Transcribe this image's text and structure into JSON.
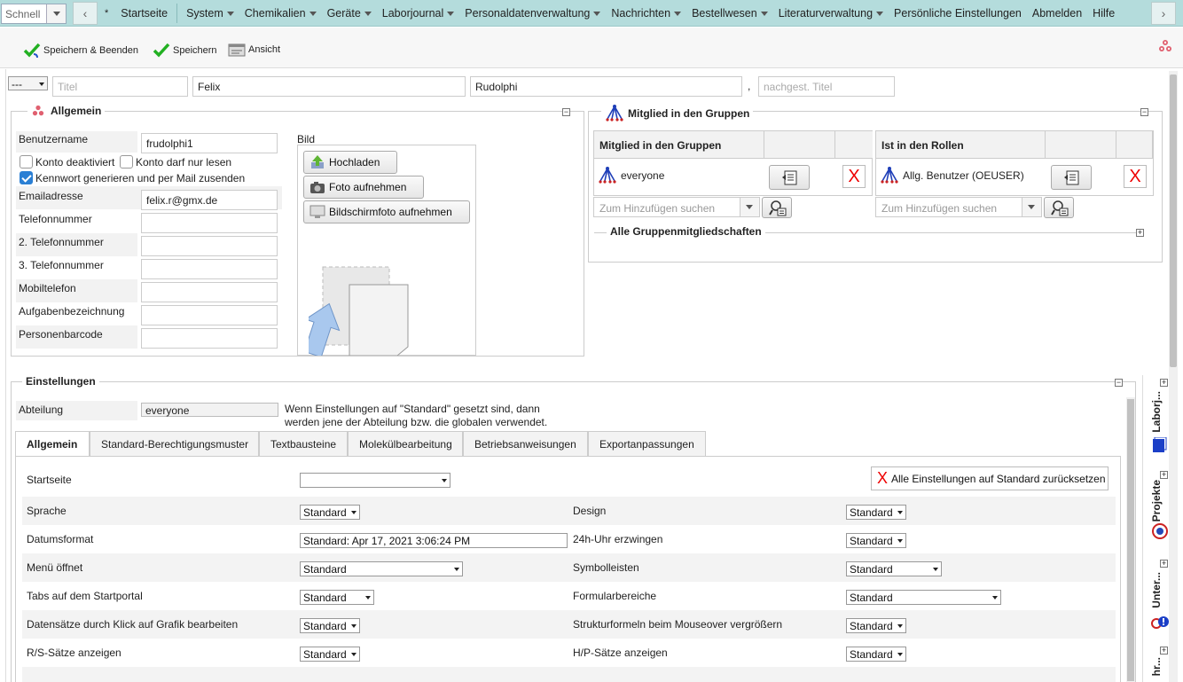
{
  "nav": {
    "quick_value": "Schnell",
    "star": "*",
    "items": [
      {
        "label": "Startseite",
        "dd": false
      },
      {
        "label": "System",
        "dd": true
      },
      {
        "label": "Chemikalien",
        "dd": true
      },
      {
        "label": "Geräte",
        "dd": true
      },
      {
        "label": "Laborjournal",
        "dd": true
      },
      {
        "label": "Personaldatenverwaltung",
        "dd": true
      },
      {
        "label": "Nachrichten",
        "dd": true
      },
      {
        "label": "Bestellwesen",
        "dd": true
      },
      {
        "label": "Literaturverwaltung",
        "dd": true
      },
      {
        "label": "Persönliche Einstellungen",
        "dd": false
      },
      {
        "label": "Abmelden",
        "dd": false
      },
      {
        "label": "Hilfe",
        "dd": false
      }
    ]
  },
  "toolbar": {
    "save_close": "Speichern & Beenden",
    "save": "Speichern",
    "view": "Ansicht"
  },
  "name_row": {
    "salutation": "---",
    "title_placeholder": "Titel",
    "first_name": "Felix",
    "last_name": "Rudolphi",
    "comma": ",",
    "post_title_placeholder": "nachgest. Titel"
  },
  "general": {
    "legend": "Allgemein",
    "username_label": "Benutzername",
    "username": "frudolphi1",
    "disabled_label": "Konto deaktiviert",
    "readonly_label": "Konto darf nur lesen",
    "pw_label": "Kennwort generieren und per Mail zusenden",
    "email_label": "Emailadresse",
    "email": "felix.r@gmx.de",
    "phone_label": "Telefonnummer",
    "phone2_label": "2. Telefonnummer",
    "phone3_label": "3. Telefonnummer",
    "mobile_label": "Mobiltelefon",
    "task_label": "Aufgabenbezeichnung",
    "barcode_label": "Personenbarcode",
    "image_label": "Bild",
    "upload": "Hochladen",
    "photo": "Foto aufnehmen",
    "screenshot": "Bildschirmfoto aufnehmen"
  },
  "groups": {
    "legend": "Mitglied in den Gruppen",
    "col_groups": "Mitglied in den Gruppen",
    "col_roles": "Ist in den Rollen",
    "group1": "everyone",
    "role1": "Allg. Benutzer (OEUSER)",
    "add_placeholder": "Zum Hinzufügen suchen",
    "remove_x": "X",
    "all_memberships": "Alle Gruppenmitgliedschaften"
  },
  "settings": {
    "legend": "Einstellungen",
    "department_label": "Abteilung",
    "department": "everyone",
    "note": "Wenn Einstellungen auf \"Standard\" gesetzt sind, dann werden jene der Abteilung bzw. die globalen verwendet.",
    "tabs": [
      "Allgemein",
      "Standard-Berechtigungsmuster",
      "Textbausteine",
      "Molekülbearbeitung",
      "Betriebsanweisungen",
      "Exportanpassungen"
    ],
    "startpage_label": "Startseite",
    "reset_x": "X",
    "reset_label": "Alle Einstellungen auf Standard zurücksetzen",
    "rows": [
      {
        "left": "Sprache",
        "lval": "Standard",
        "right": "Design",
        "rval": "Standard"
      },
      {
        "left": "Datumsformat",
        "lval": "Standard: Apr 17, 2021 3:06:24 PM",
        "right": "24h-Uhr erzwingen",
        "rval": "Standard"
      },
      {
        "left": "Menü öffnet",
        "lval": "Standard",
        "right": "Symbolleisten",
        "rval": "Standard"
      },
      {
        "left": "Tabs auf dem Startportal",
        "lval": "Standard",
        "right": "Formularbereiche",
        "rval": "Standard"
      },
      {
        "left": "Datensätze durch Klick auf Grafik bearbeiten",
        "lval": "Standard",
        "right": "Strukturformeln beim Mouseover vergrößern",
        "rval": "Standard"
      },
      {
        "left": "R/S-Sätze anzeigen",
        "lval": "Standard",
        "right": "H/P-Sätze anzeigen",
        "rval": "Standard"
      }
    ]
  },
  "side": {
    "items": [
      "Laborj...",
      "Projekte",
      "Unter...",
      "hr..."
    ]
  },
  "icons": {
    "save_close": "check-arrow-icon",
    "save": "check-icon",
    "view": "view-icon",
    "group": "group-tree-icon",
    "app": "lab-app-icon"
  }
}
